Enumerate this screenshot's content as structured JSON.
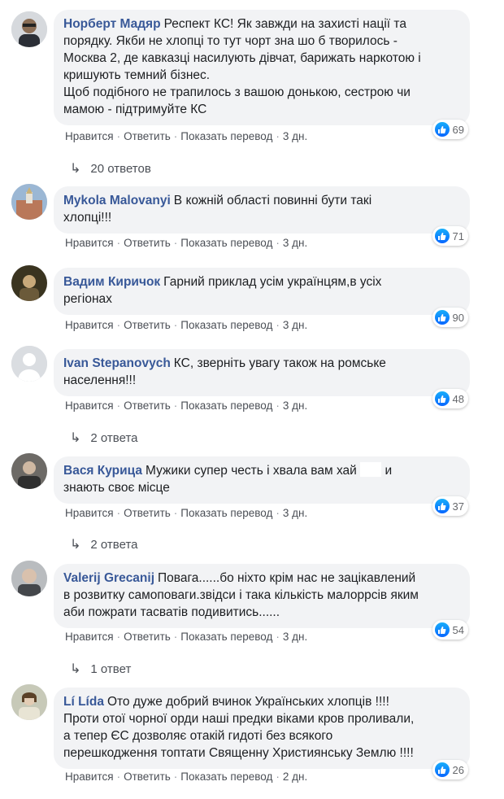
{
  "comments": [
    {
      "author": "Норберт Мадяр",
      "lines": [
        "Респект КС! Як завжди на захисті нації та",
        "порядку. Якби не хлопці то тут чорт зна шо б творилось -",
        "Москва 2, де кавказці насилують дівчат, барижать наркотою і",
        "кришують темний бізнес.",
        "Щоб подібного не трапилось з вашою донькою, сестрою чи",
        "мамою - підтримуйте КС"
      ],
      "likes": "69",
      "time": "3 дн.",
      "replies": "20 ответов"
    },
    {
      "author": "Mykola Malovanyi",
      "lines": [
        "В кожній області повинні бути такі",
        "хлопці!!!"
      ],
      "likes": "71",
      "time": "3 дн.",
      "replies": ""
    },
    {
      "author": "Вадим Киричок",
      "lines": [
        "Гарний приклад усім українцям,в усіх",
        "регіонах"
      ],
      "likes": "90",
      "time": "3 дн.",
      "replies": ""
    },
    {
      "author": "Ivan Stepanovych",
      "lines": [
        "КС, зверніть увагу також на ромське",
        "населення!!!"
      ],
      "likes": "48",
      "time": "3 дн.",
      "replies": "2 ответа"
    },
    {
      "author": "Вася Курица",
      "lines": [
        "Мужики супер честь і хвала вам хай",
        "знають своє місце"
      ],
      "line1_suffix": "и",
      "likes": "37",
      "time": "3 дн.",
      "replies": "2 ответа"
    },
    {
      "author": "Valerij Grecanij",
      "lines": [
        "Повага......бо ніхто крім нас не зацікавлений",
        "в розвитку самоповаги.звідси і така кількість малоррсів яким",
        "аби пожрати тасватів подивитись......"
      ],
      "likes": "54",
      "time": "3 дн.",
      "replies": "1 ответ"
    },
    {
      "author": "Lí Lída",
      "lines": [
        "Ото дуже добрий вчинок Українських хлопців !!!!",
        "Проти отої чорної орди наші предки віками кров проливали,",
        "а тепер ЄС дозволяє отакій гидоті без всякого",
        "перешкодження топтати Священну Християнську Землю !!!!"
      ],
      "likes": "26",
      "time": "2 дн.",
      "replies": ""
    }
  ],
  "actions": {
    "like": "Нравится",
    "reply": "Ответить",
    "translate": "Показать перевод"
  },
  "colors": {
    "author": "#385898",
    "bubble": "#f2f3f5",
    "like": "#0866ff"
  }
}
